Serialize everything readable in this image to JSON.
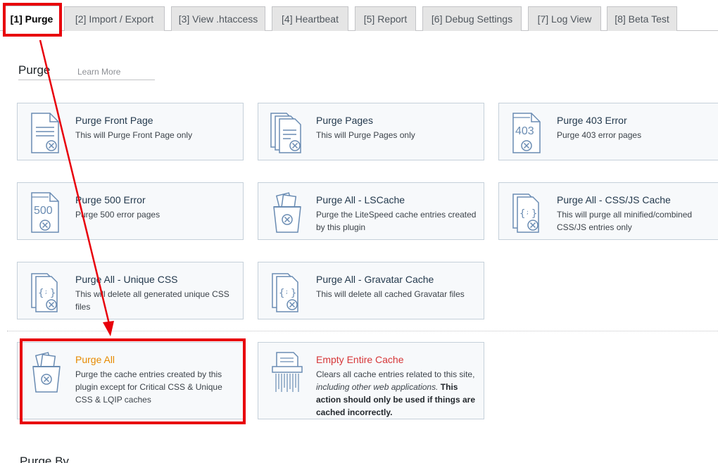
{
  "tabs": [
    {
      "label": "[1] Purge",
      "active": true
    },
    {
      "label": "[2] Import / Export",
      "active": false
    },
    {
      "label": "[3] View .htaccess",
      "active": false
    },
    {
      "label": "[4] Heartbeat",
      "active": false
    },
    {
      "label": "[5] Report",
      "active": false
    },
    {
      "label": "[6] Debug Settings",
      "active": false
    },
    {
      "label": "[7] Log View",
      "active": false
    },
    {
      "label": "[8] Beta Test",
      "active": false
    }
  ],
  "section": {
    "title": "Purge",
    "learn_more": "Learn More"
  },
  "cards": [
    {
      "title": "Purge Front Page",
      "desc": "This will Purge Front Page only",
      "icon": "document-x-icon"
    },
    {
      "title": "Purge Pages",
      "desc": "This will Purge Pages only",
      "icon": "documents-x-icon"
    },
    {
      "title": "Purge 403 Error",
      "desc": "Purge 403 error pages",
      "icon": "error-403-icon",
      "icon_text": "403"
    },
    {
      "title": "Purge 500 Error",
      "desc": "Purge 500 error pages",
      "icon": "error-500-icon",
      "icon_text": "500"
    },
    {
      "title": "Purge All - LSCache",
      "desc": "Purge the LiteSpeed cache entries created by this plugin",
      "icon": "trash-x-icon"
    },
    {
      "title": "Purge All - CSS/JS Cache",
      "desc": "This will purge all minified/combined CSS/JS entries only",
      "icon": "code-file-x-icon"
    },
    {
      "title": "Purge All - Unique CSS",
      "desc": "This will delete all generated unique CSS files",
      "icon": "code-file-x-icon"
    },
    {
      "title": "Purge All - Gravatar Cache",
      "desc": "This will delete all cached Gravatar files",
      "icon": "code-file-x-icon"
    },
    {
      "title": "Purge All",
      "desc": "Purge the cache entries created by this plugin except for Critical CSS & Unique CSS & LQIP caches",
      "icon": "trash-x-icon"
    },
    {
      "title": "Empty Entire Cache",
      "desc_plain": "Clears all cache entries related to this site,",
      "desc_em": "including other web applications.",
      "desc_strong": "This action should only be used if things are cached incorrectly.",
      "icon": "shredder-icon"
    }
  ],
  "purge_by": "Purge By",
  "colors": {
    "annotation": "#e8000b",
    "card_bg": "#f7f9fb",
    "icon_stroke": "#6a8cb3",
    "orange_title": "#e68a00",
    "red_title": "#d63638"
  }
}
